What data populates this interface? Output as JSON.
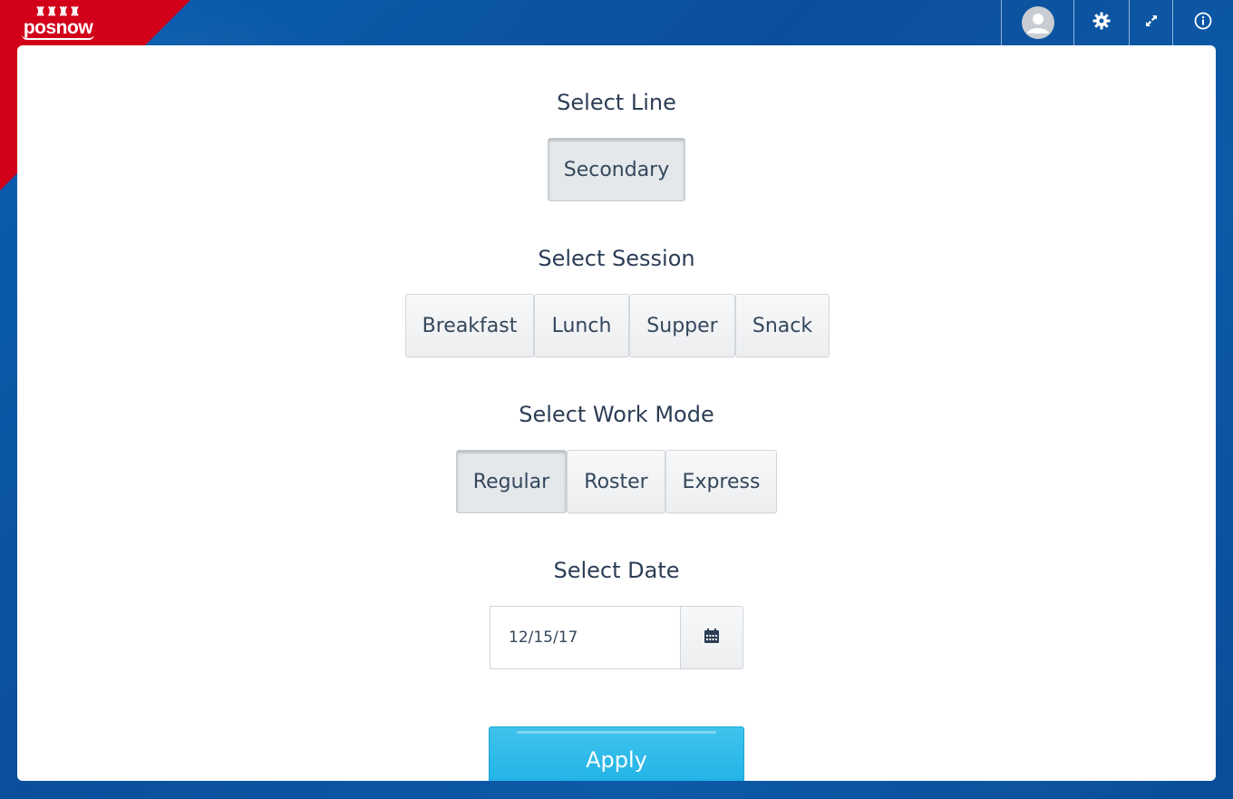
{
  "brand": {
    "logo_text": "posnow",
    "accent_red": "#d3001a",
    "background_blue": "#0b5aa8"
  },
  "topbar": {
    "icons": [
      "user-avatar-icon",
      "gear-icon",
      "expand-icon",
      "info-icon"
    ]
  },
  "line": {
    "title": "Select Line",
    "options": [
      "Secondary"
    ],
    "selected": "Secondary"
  },
  "session": {
    "title": "Select Session",
    "options": [
      "Breakfast",
      "Lunch",
      "Supper",
      "Snack"
    ]
  },
  "work_mode": {
    "title": "Select Work Mode",
    "options": [
      "Regular",
      "Roster",
      "Express"
    ],
    "selected": "Regular"
  },
  "date": {
    "title": "Select Date",
    "value": "12/15/17",
    "picker_icon": "calendar-icon"
  },
  "apply": {
    "label": "Apply",
    "color": "#29b8ea"
  }
}
